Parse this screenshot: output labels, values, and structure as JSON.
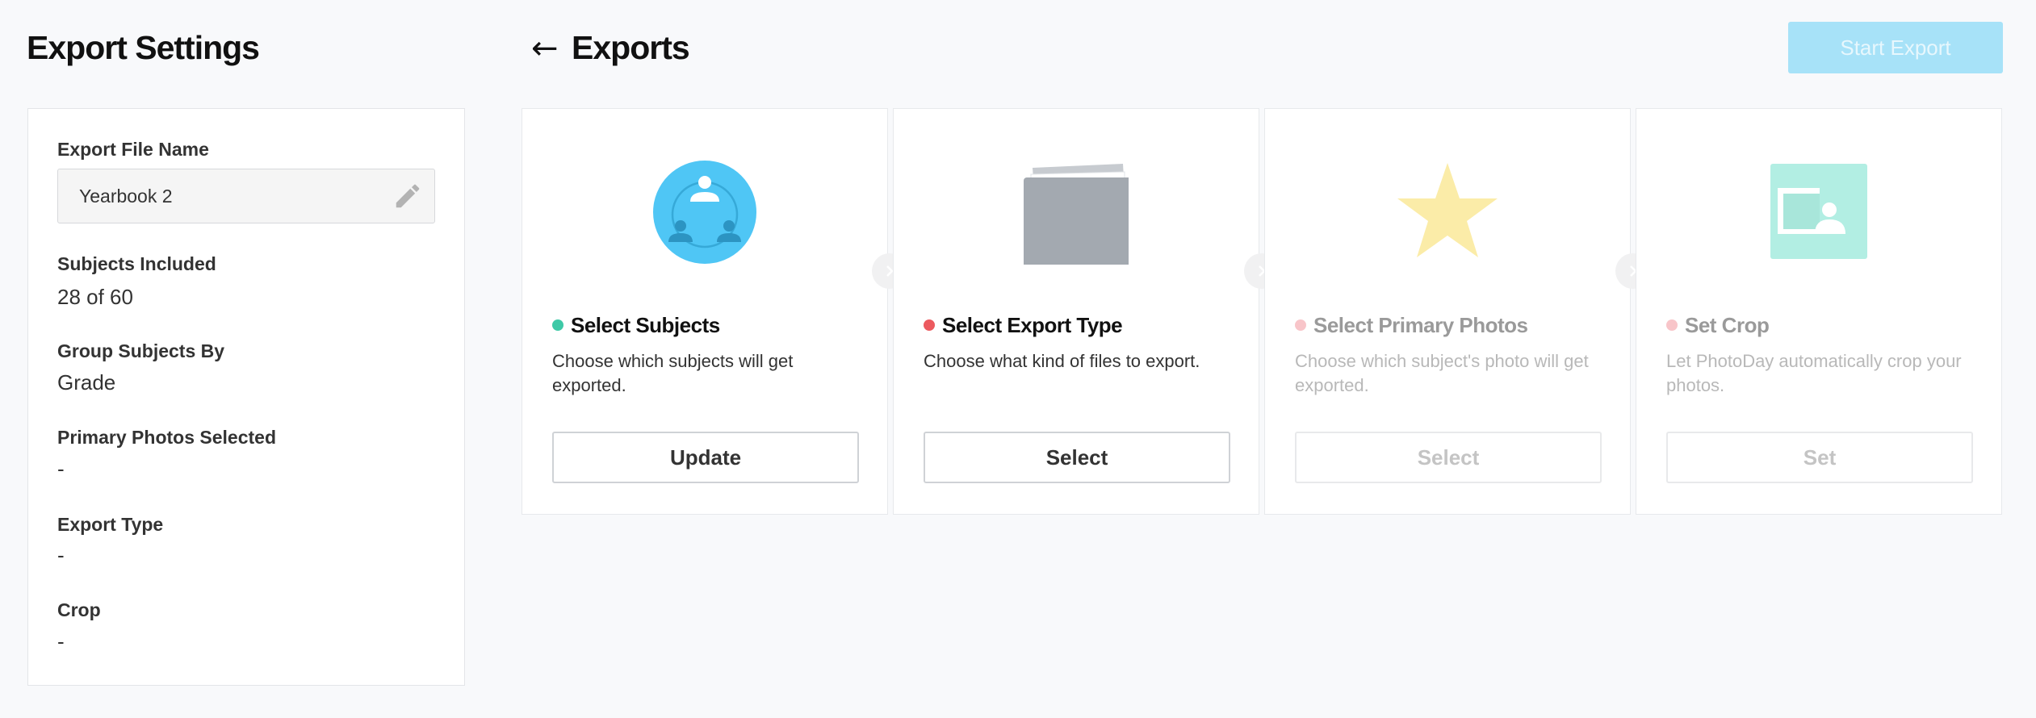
{
  "sidebar": {
    "title": "Export Settings",
    "export_file_name": {
      "label": "Export File Name",
      "value": "Yearbook 2"
    },
    "subjects_included": {
      "label": "Subjects Included",
      "value": "28 of 60"
    },
    "group_subjects_by": {
      "label": "Group Subjects By",
      "value": "Grade"
    },
    "primary_photos_selected": {
      "label": "Primary Photos Selected",
      "value": "-"
    },
    "export_type": {
      "label": "Export Type",
      "value": "-"
    },
    "crop": {
      "label": "Crop",
      "value": "-"
    }
  },
  "header": {
    "title": "Exports",
    "start_export_label": "Start Export"
  },
  "steps": [
    {
      "title": "Select Subjects",
      "description": "Choose which subjects will get exported.",
      "button": "Update",
      "status": "complete",
      "dot_color": "#3ec9a7",
      "icon": "subjects-group-icon"
    },
    {
      "title": "Select Export Type",
      "description": "Choose what kind of files to export.",
      "button": "Select",
      "status": "required",
      "dot_color": "#ec5a5f",
      "icon": "folder-icon"
    },
    {
      "title": "Select Primary Photos",
      "description": "Choose which subject's photo will get exported.",
      "button": "Select",
      "status": "disabled",
      "dot_color": "#f8c5c9",
      "icon": "star-icon"
    },
    {
      "title": "Set Crop",
      "description": "Let PhotoDay automatically crop your photos.",
      "button": "Set",
      "status": "disabled",
      "dot_color": "#f8c5c9",
      "icon": "crop-photo-icon"
    }
  ],
  "colors": {
    "accent": "#a7e2f8",
    "complete": "#3ec9a7",
    "required": "#ec5a5f",
    "subjects_icon": "#4fc6f5",
    "folder_icon": "#a3a9b0",
    "star_icon": "#fbeca8",
    "crop_icon": "#b2eee3"
  }
}
